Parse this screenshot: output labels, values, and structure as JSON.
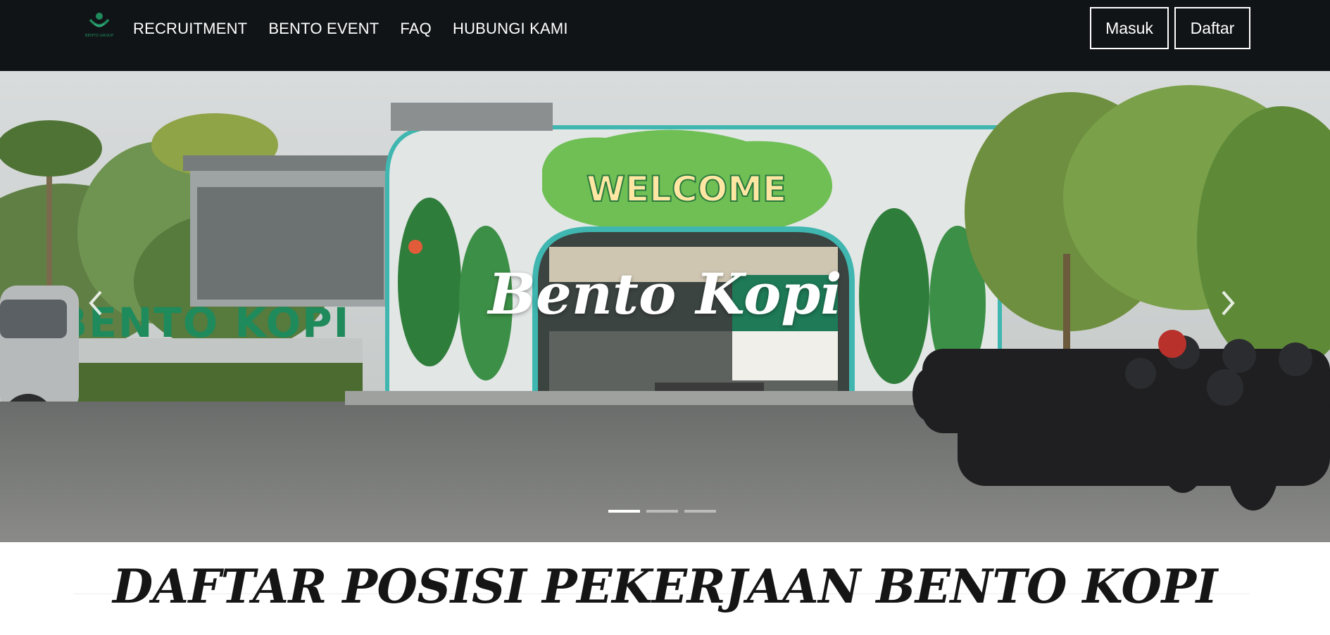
{
  "brand": {
    "logo_icon": "bento-group-logo",
    "logo_text": "BENTO GROUP",
    "logo_color": "#1f8a5b"
  },
  "nav": {
    "items": [
      {
        "label": "RECRUITMENT"
      },
      {
        "label": "BENTO EVENT"
      },
      {
        "label": "FAQ"
      },
      {
        "label": "HUBUNGI KAMI"
      }
    ],
    "login_label": "Masuk",
    "register_label": "Daftar"
  },
  "hero": {
    "slide_title": "Bento Kopi",
    "sign_text": "BENTO KOPI",
    "mural_text": "WELCOME",
    "prev_icon": "chevron-left-icon",
    "next_icon": "chevron-right-icon",
    "slides_count": 3,
    "active_slide": 1
  },
  "section": {
    "title": "DAFTAR POSISI PEKERJAAN BENTO KOPI"
  },
  "colors": {
    "navbar_bg": "#111417",
    "teal_trim": "#3fb7b0",
    "sign_green": "#1f8a5b"
  }
}
